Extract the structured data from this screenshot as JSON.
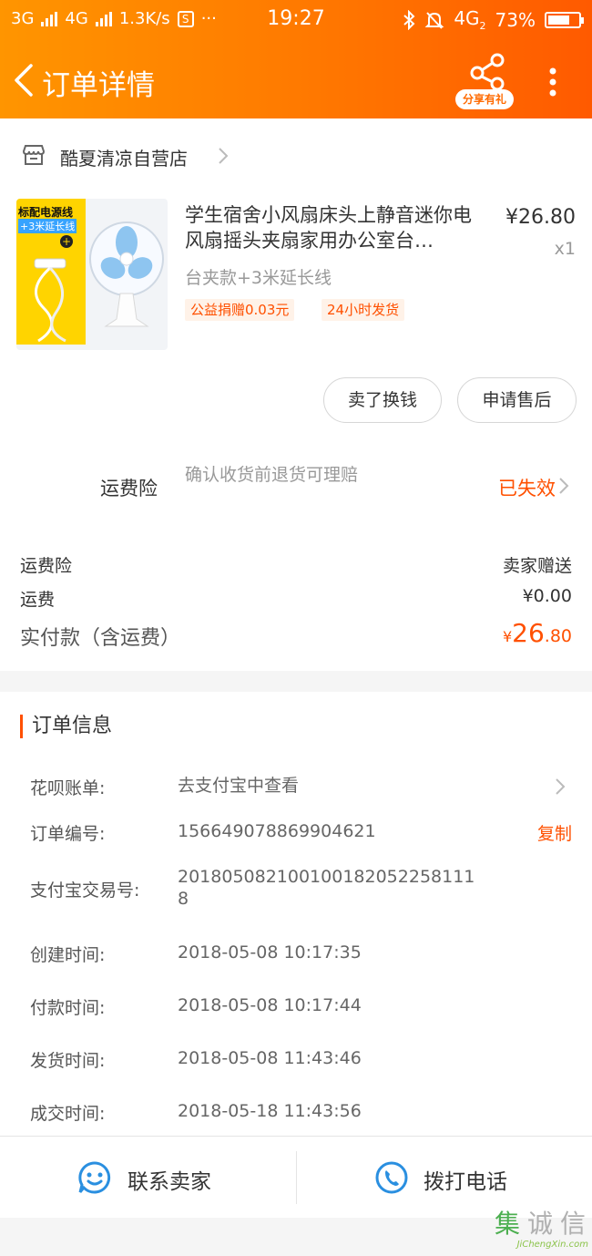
{
  "status_bar": {
    "left_net1": "3G",
    "left_net2": "4G",
    "speed": "1.3K/s",
    "s_icon": "S",
    "dots": "···",
    "time": "19:27",
    "net_right": "4G",
    "net_right_sub": "2",
    "battery": "73%",
    "battery_level": 0.73
  },
  "navbar": {
    "title": "订单详情",
    "share_label": "分享有礼"
  },
  "shop": {
    "name": "酷夏清凉自营店"
  },
  "product": {
    "thumb_line1": "标配电源线",
    "thumb_line2": "+3米延长线",
    "thumb_plus": "+",
    "title": "学生宿舍小风扇床头上静音迷你电风扇摇头夹扇家用办公室台…",
    "price": "¥26.80",
    "qty": "x1",
    "spec": "台夹款+3米延长线",
    "tags": [
      "公益捐赠0.03元",
      "24小时发货"
    ]
  },
  "actions": {
    "sell_swap": "卖了换钱",
    "after_sale": "申请售后"
  },
  "insurance": {
    "label": "运费险",
    "desc": "确认收货前退货可理赔",
    "status": "已失效"
  },
  "fees": {
    "ins_label": "运费险",
    "ins_value": "卖家赠送",
    "ship_label": "运费",
    "ship_value": "¥0.00",
    "total_label": "实付款（含运费）",
    "total_currency": "¥",
    "total_int": "26",
    "total_dec": ".80"
  },
  "order_info": {
    "title": "订单信息",
    "huabei_label": "花呗账单:",
    "huabei_value": "去支付宝中查看",
    "order_no_label": "订单编号:",
    "order_no": "156649078869904621",
    "copy": "复制",
    "alipay_label": "支付宝交易号:",
    "alipay_no": "201805082100100182052258111 8",
    "created_label": "创建时间:",
    "created": "2018-05-08 10:17:35",
    "paid_label": "付款时间:",
    "paid": "2018-05-08 10:17:44",
    "shipped_label": "发货时间:",
    "shipped": "2018-05-08 11:43:46",
    "done_label": "成交时间:",
    "done": "2018-05-18 11:43:56"
  },
  "bottom": {
    "contact": "联系卖家",
    "call": "拨打电话"
  },
  "watermark": {
    "chars": [
      "集",
      "诚",
      "信"
    ],
    "sub": "JiChengXin.com"
  },
  "colors": {
    "accent": "#ff5000",
    "header_start": "#ff9500",
    "header_end": "#ff5a00",
    "icon_blue": "#2a8fe0"
  }
}
